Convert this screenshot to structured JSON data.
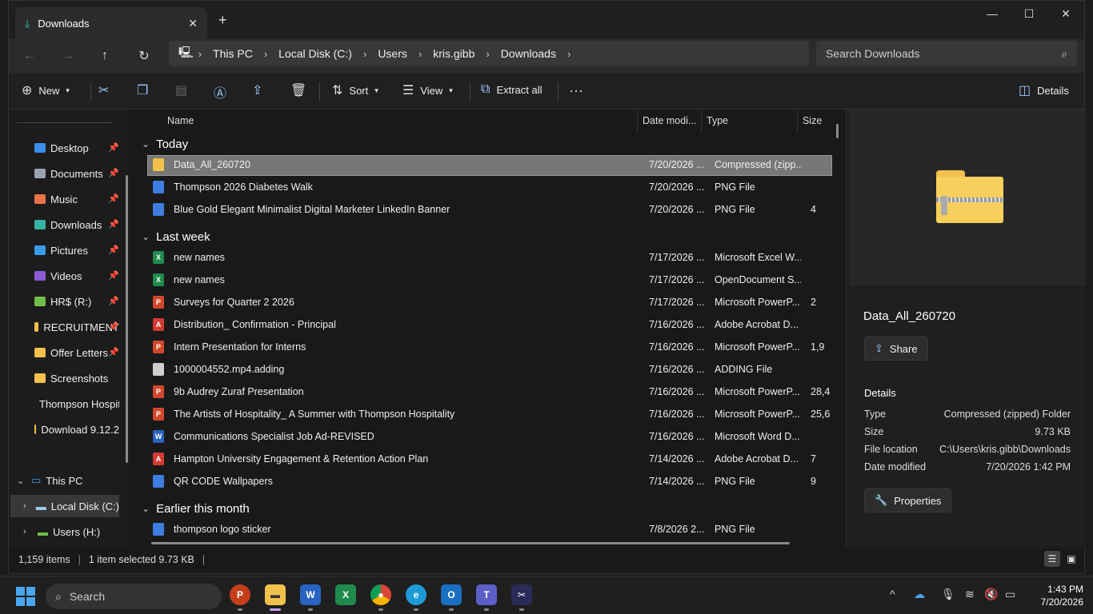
{
  "window": {
    "tab_title": "Downloads",
    "close_tab": "✕",
    "new_tab": "+"
  },
  "nav": {
    "breadcrumbs": [
      "This PC",
      "Local Disk (C:)",
      "Users",
      "kris.gibb",
      "Downloads"
    ],
    "search_placeholder": "Search Downloads"
  },
  "toolbar": {
    "new_label": "New",
    "sort_label": "Sort",
    "view_label": "View",
    "extract_label": "Extract all",
    "details_label": "Details"
  },
  "sidebar": {
    "quick_access": [
      {
        "label": "Desktop",
        "icon": "desktop-icon",
        "color": "#3b8ee8"
      },
      {
        "label": "Documents",
        "icon": "documents-icon",
        "color": "#9aa4b2"
      },
      {
        "label": "Music",
        "icon": "music-icon",
        "color": "#e8734a"
      },
      {
        "label": "Downloads",
        "icon": "downloads-icon",
        "color": "#35b5a5"
      },
      {
        "label": "Pictures",
        "icon": "pictures-icon",
        "color": "#3b9be8"
      },
      {
        "label": "Videos",
        "icon": "videos-icon",
        "color": "#8a5cd6"
      },
      {
        "label": "HR$ (R:)",
        "icon": "network-drive-icon",
        "color": "#6fbf4a"
      },
      {
        "label": "RECRUITMENT",
        "icon": "folder-icon",
        "color": "#f2c14b"
      },
      {
        "label": "Offer Letters",
        "icon": "folder-icon",
        "color": "#f2c14b"
      },
      {
        "label": "Screenshots",
        "icon": "folder-icon",
        "color": "#f2c14b"
      },
      {
        "label": "Thompson Hospitality",
        "icon": "folder-icon",
        "color": "#f2c14b"
      },
      {
        "label": "Download 9.12.2",
        "icon": "folder-icon",
        "color": "#f2c14b"
      }
    ],
    "this_pc": "This PC",
    "local_disk": "Local Disk (C:)",
    "users_drive": "Users (H:)"
  },
  "columns": {
    "name": "Name",
    "date": "Date modi...",
    "type": "Type",
    "size": "Size"
  },
  "groups": [
    {
      "label": "Today",
      "files": [
        {
          "name": "Data_All_260720",
          "date": "7/20/2026 ...",
          "type": "Compressed (zipp...",
          "size": "",
          "kind": "zip",
          "selected": true
        },
        {
          "name": "Thompson 2026 Diabetes Walk",
          "date": "7/20/2026 ...",
          "type": "PNG File",
          "size": "",
          "kind": "png"
        },
        {
          "name": "Blue Gold Elegant Minimalist Digital Marketer LinkedIn Banner",
          "date": "7/20/2026 ...",
          "type": "PNG File",
          "size": "4",
          "kind": "png"
        }
      ]
    },
    {
      "label": "Last week",
      "files": [
        {
          "name": "new names",
          "date": "7/17/2026 ...",
          "type": "Microsoft Excel W...",
          "size": "",
          "kind": "xls"
        },
        {
          "name": "new names",
          "date": "7/17/2026 ...",
          "type": "OpenDocument S...",
          "size": "",
          "kind": "xls"
        },
        {
          "name": "Surveys for Quarter 2 2026",
          "date": "7/17/2026 ...",
          "type": "Microsoft PowerP...",
          "size": "2",
          "kind": "ppt"
        },
        {
          "name": "Distribution_ Confirmation - Principal",
          "date": "7/16/2026 ...",
          "type": "Adobe Acrobat D...",
          "size": "",
          "kind": "pdf"
        },
        {
          "name": "Intern Presentation for Interns",
          "date": "7/16/2026 ...",
          "type": "Microsoft PowerP...",
          "size": "1,9",
          "kind": "ppt"
        },
        {
          "name": "1000004552.mp4.adding",
          "date": "7/16/2026 ...",
          "type": "ADDING File",
          "size": "",
          "kind": "file"
        },
        {
          "name": "9b Audrey Zuraf Presentation",
          "date": "7/16/2026 ...",
          "type": "Microsoft PowerP...",
          "size": "28,4",
          "kind": "ppt"
        },
        {
          "name": "The Artists of Hospitality_ A Summer with Thompson Hospitality",
          "date": "7/16/2026 ...",
          "type": "Microsoft PowerP...",
          "size": "25,6",
          "kind": "ppt"
        },
        {
          "name": "Communications Specialist Job Ad-REVISED",
          "date": "7/16/2026 ...",
          "type": "Microsoft Word D...",
          "size": "",
          "kind": "doc"
        },
        {
          "name": "Hampton University Engagement & Retention Action Plan",
          "date": "7/14/2026 ...",
          "type": "Adobe Acrobat D...",
          "size": "7",
          "kind": "pdf"
        },
        {
          "name": "QR CODE Wallpapers",
          "date": "7/14/2026 ...",
          "type": "PNG File",
          "size": "9",
          "kind": "png"
        }
      ]
    },
    {
      "label": "Earlier this month",
      "files": [
        {
          "name": "thompson logo sticker",
          "date": "7/8/2026 2...",
          "type": "PNG File",
          "size": "",
          "kind": "png"
        }
      ]
    }
  ],
  "details": {
    "title": "Data_All_260720",
    "share_label": "Share",
    "heading": "Details",
    "rows": [
      {
        "label": "Type",
        "value": "Compressed (zipped) Folder"
      },
      {
        "label": "Size",
        "value": "9.73 KB"
      },
      {
        "label": "File location",
        "value": "C:\\Users\\kris.gibb\\Downloads"
      },
      {
        "label": "Date modified",
        "value": "7/20/2026 1:42 PM"
      }
    ],
    "properties_label": "Properties"
  },
  "status": {
    "count": "1,159 items",
    "selected": "1 item selected  9.73 KB"
  },
  "taskbar": {
    "search_label": "Search",
    "time": "1:43 PM",
    "date": "7/20/2026"
  },
  "icon_colors": {
    "zip": "#f2c14b",
    "png": "#3d7ee0",
    "xls": "#1f8a4c",
    "ppt": "#d2472b",
    "pdf": "#d33a32",
    "doc": "#2b63c4",
    "file": "#cfcfcf"
  }
}
